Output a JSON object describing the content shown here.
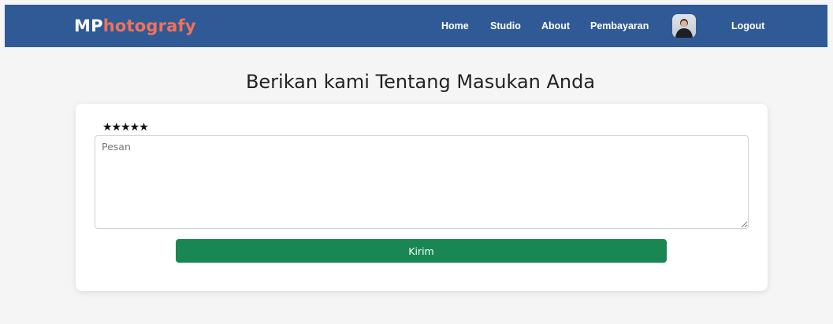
{
  "navbar": {
    "brand_prefix": "MP",
    "brand_suffix": "hotografy",
    "links": [
      "Home",
      "Studio",
      "About",
      "Pembayaran"
    ],
    "avatar_icon": "user-avatar-icon",
    "logout_label": "Logout",
    "colors": {
      "background": "#2f5a96",
      "brand_accent": "#f0725a"
    }
  },
  "page": {
    "heading": "Berikan kami Tentang Masukan Anda"
  },
  "feedback_form": {
    "rating_stars": "★★★★★",
    "rating_value": 5,
    "rating_max": 5,
    "message_placeholder": "Pesan",
    "message_value": "",
    "submit_label": "Kirim",
    "colors": {
      "submit_button": "#198754"
    }
  }
}
